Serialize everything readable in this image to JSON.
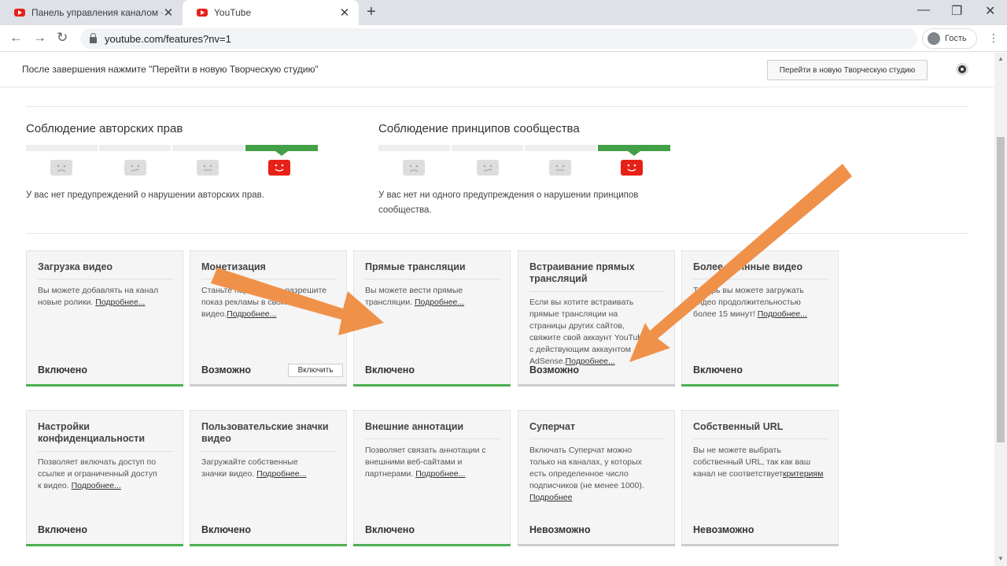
{
  "browser": {
    "tabs": [
      {
        "title": "Панель управления каналом - Y"
      },
      {
        "title": "YouTube"
      }
    ],
    "url": "youtube.com/features?nv=1",
    "profile_label": "Гость"
  },
  "notice": {
    "message": "После завершения нажмите \"Перейти в новую Творческую студию\"",
    "button_label": "Перейти в новую Творческую студию"
  },
  "copyright": {
    "title": "Соблюдение авторских прав",
    "description": "У вас нет предупреждений о нарушении авторских прав.",
    "active_level": 4
  },
  "community": {
    "title": "Соблюдение принципов сообщества",
    "description_line1": "У вас нет ни одного предупреждения о нарушении принципов",
    "description_line2": "сообщества.",
    "active_level": 4
  },
  "cards_row1": [
    {
      "title": "Загрузка видео",
      "desc_lines": [
        "Вы можете добавлять на канал",
        "новые ролики. "
      ],
      "link": "Подробнее...",
      "status": "Включено",
      "status_color": "#4caf50"
    },
    {
      "title": "Монетизация",
      "desc_lines": [
        "Станьте партнером и разрешите",
        "показ рекламы в своих видео."
      ],
      "link": "Подробнее...",
      "status": "Возможно",
      "status_color": "#cccccc",
      "button": "Включить"
    },
    {
      "title": "Прямые трансляции",
      "desc_lines": [
        "Вы можете вести прямые",
        "трансляции. "
      ],
      "link": "Подробнее...",
      "status": "Включено",
      "status_color": "#4caf50"
    },
    {
      "title": "Встраивание прямых трансляций",
      "desc_lines": [
        "Если вы хотите встраивать",
        "прямые трансляции на",
        "страницы других сайтов,",
        "свяжите свой аккаунт YouTube",
        "с действующим аккаунтом",
        "AdSense."
      ],
      "link": "Подробнее...",
      "status": "Возможно",
      "status_color": "#cccccc"
    },
    {
      "title": "Более длинные видео",
      "desc_lines": [
        "Теперь вы можете загружать",
        "видео продолжительностью",
        "более 15 минут! "
      ],
      "link": "Подробнее...",
      "status": "Включено",
      "status_color": "#4caf50"
    }
  ],
  "cards_row2": [
    {
      "title": "Настройки конфиденциальности",
      "desc_lines": [
        "Позволяет включать доступ по",
        "ссылке и ограниченный доступ",
        "к видео. "
      ],
      "link": "Подробнее...",
      "status": "Включено",
      "status_color": "#4caf50"
    },
    {
      "title": "Пользовательские значки видео",
      "desc_lines": [
        "Загружайте собственные",
        "значки видео. "
      ],
      "link": "Подробнее...",
      "status": "Включено",
      "status_color": "#4caf50"
    },
    {
      "title": "Внешние аннотации",
      "desc_lines": [
        "Позволяет связать аннотации с",
        "внешними веб-сайтами и",
        "партнерами. "
      ],
      "link": "Подробнее...",
      "status": "Включено",
      "status_color": "#4caf50"
    },
    {
      "title": "Суперчат",
      "desc_lines": [
        "Включать Суперчат можно",
        "только на каналах, у которых",
        "есть определенное число",
        "подписчиков (не менее 1000)."
      ],
      "link": "Подробнее",
      "status": "Невозможно",
      "status_color": "#cccccc"
    },
    {
      "title": "Собственный URL",
      "desc_lines": [
        "Вы не можете выбрать",
        "собственный URL, так как ваш",
        "канал не соответствует"
      ],
      "link": "критериям",
      "status": "Невозможно",
      "status_color": "#cccccc"
    }
  ],
  "annotation_color": "#f0914a"
}
